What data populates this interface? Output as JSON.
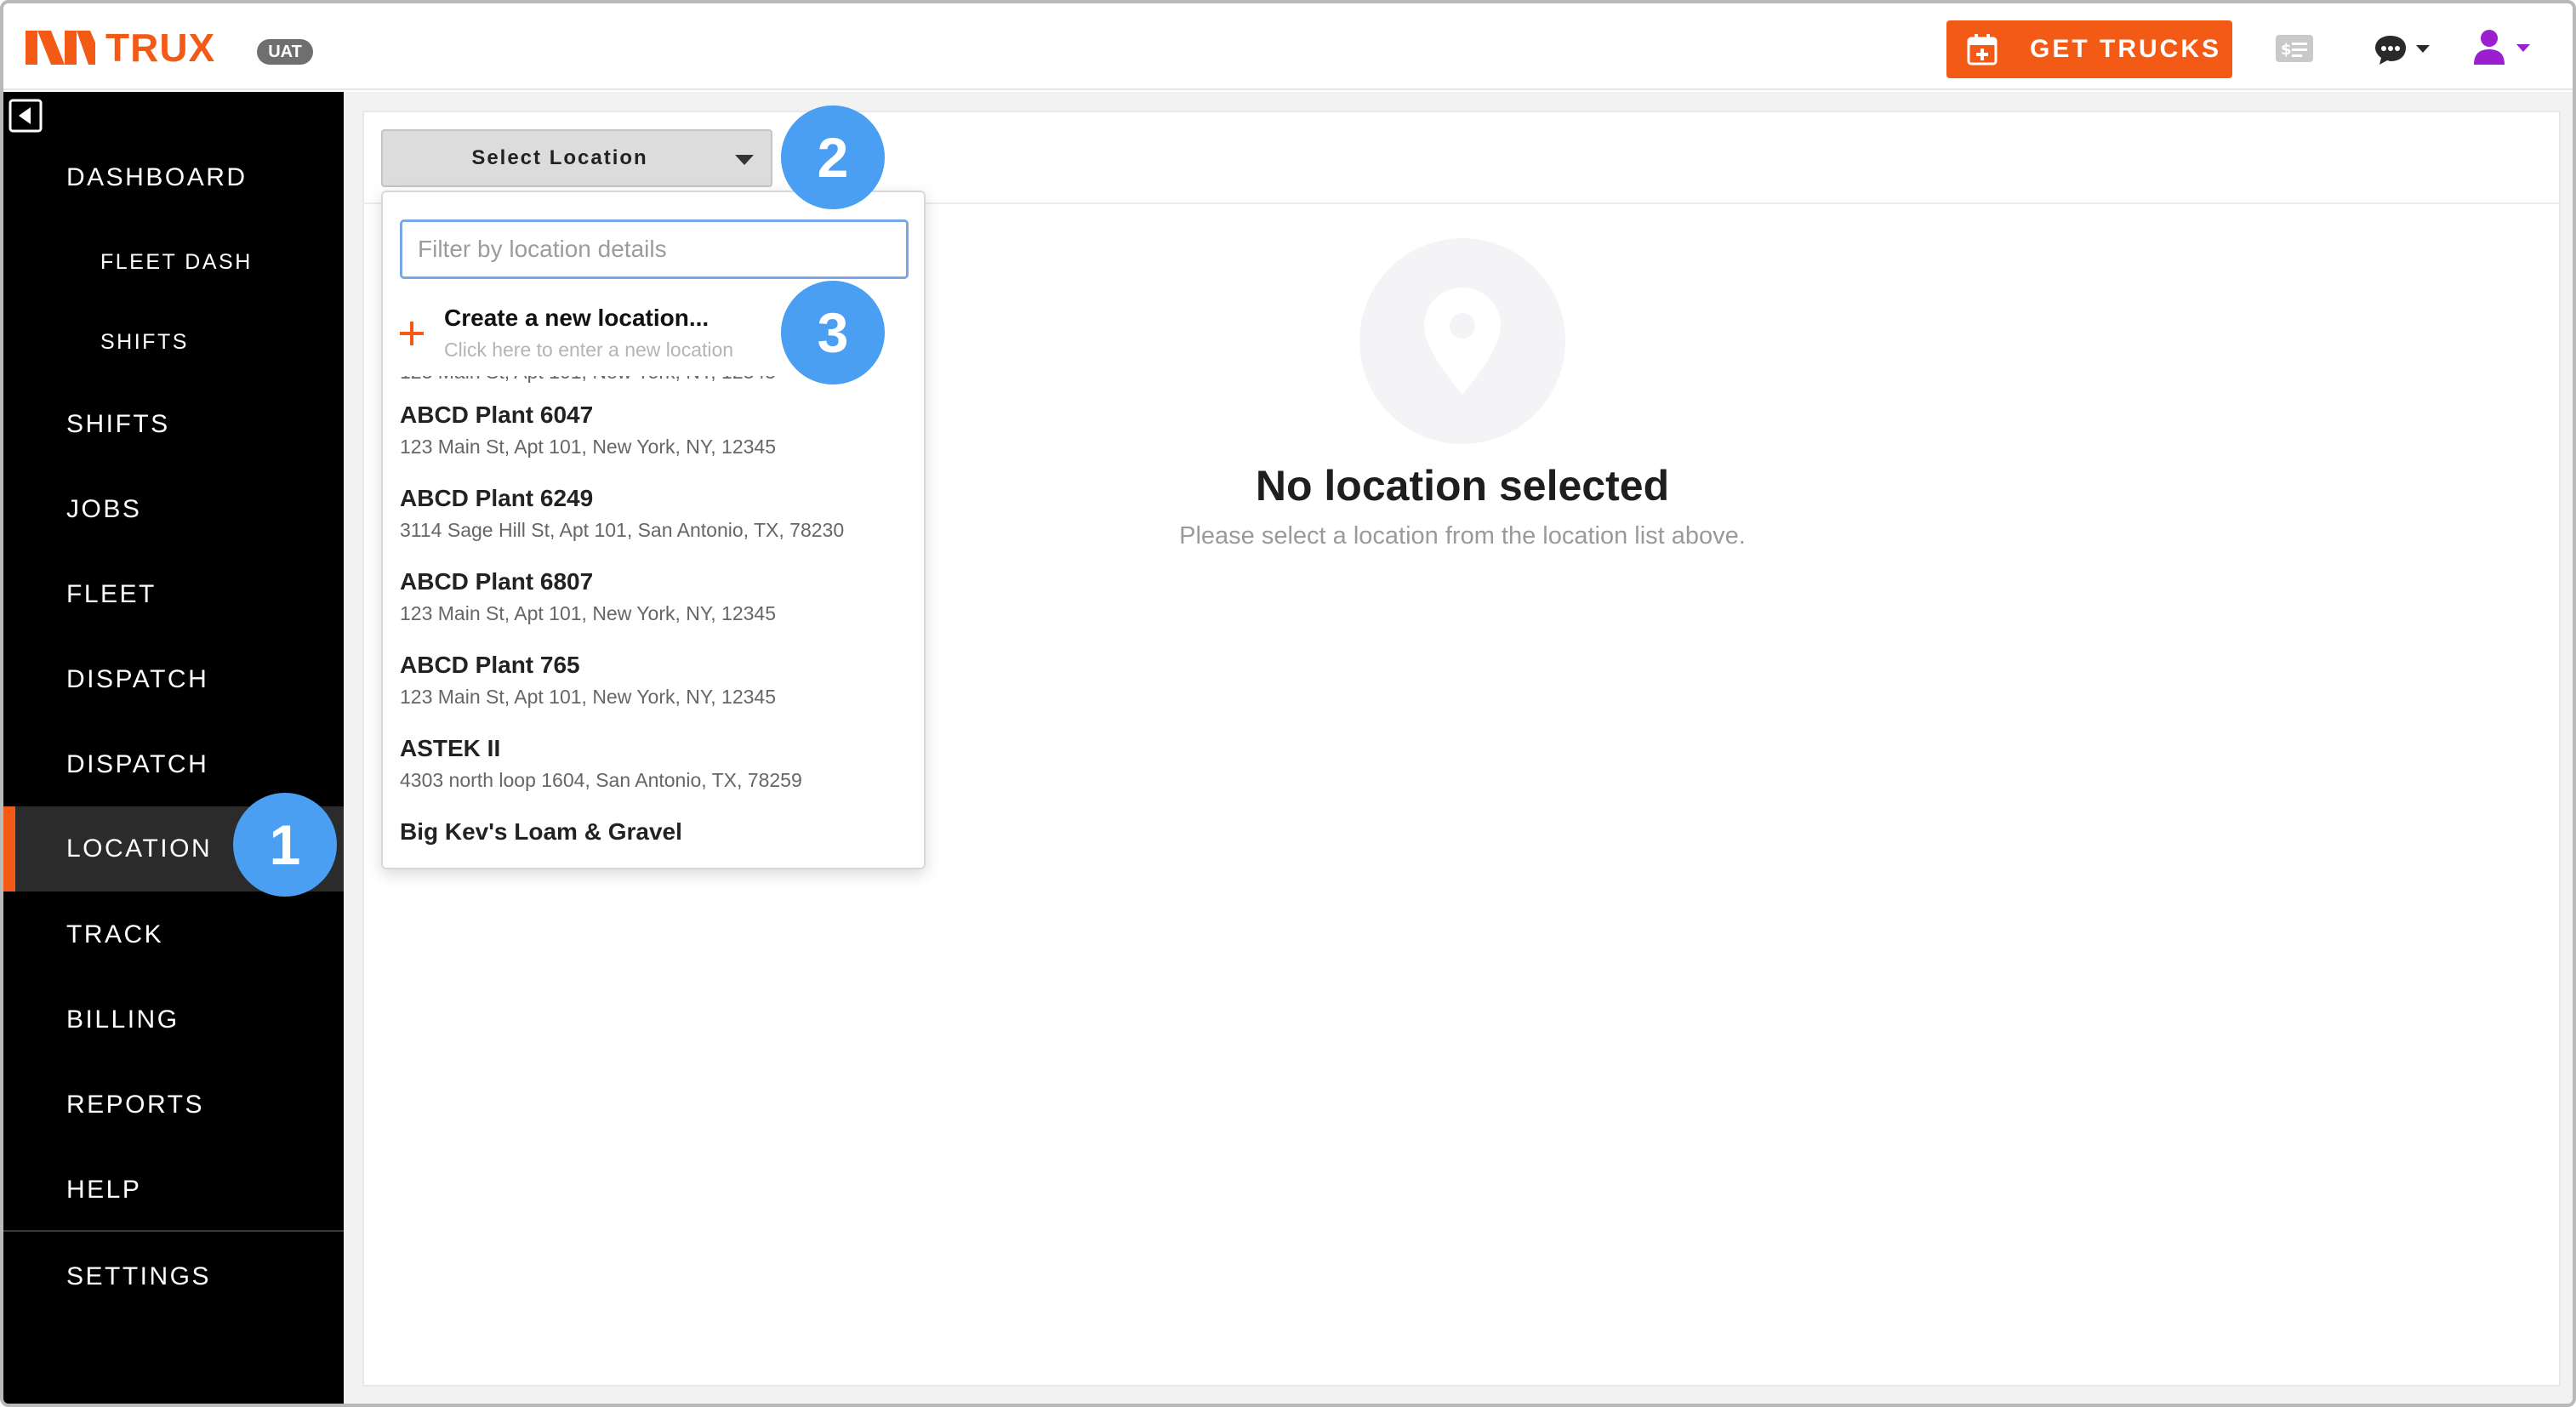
{
  "header": {
    "brand": "TRUX",
    "env_badge": "UAT",
    "get_trucks_label": "GET TRUCKS",
    "icons": [
      "calendar-plus-icon",
      "billing-icon",
      "chat-icon",
      "user-icon"
    ],
    "accent_color": "#f25a16"
  },
  "sidebar": {
    "items": [
      {
        "label": "DASHBOARD"
      },
      {
        "label": "FLEET DASH"
      },
      {
        "label": "SHIFTS"
      },
      {
        "label": "SHIFTS"
      },
      {
        "label": "JOBS"
      },
      {
        "label": "FLEET"
      },
      {
        "label": "DISPATCH"
      },
      {
        "label": "DISPATCH"
      },
      {
        "label": "LOCATION"
      },
      {
        "label": "TRACK"
      },
      {
        "label": "BILLING"
      },
      {
        "label": "REPORTS"
      },
      {
        "label": "HELP"
      },
      {
        "label": "SETTINGS"
      }
    ],
    "active": "LOCATION"
  },
  "toolbar": {
    "select_location_label": "Select Location"
  },
  "dropdown": {
    "filter_placeholder": "Filter by location details",
    "create": {
      "title": "Create a new location...",
      "subtitle": "Click here to enter a new location"
    },
    "partial_addr": "123 Main St, Apt 101, New York, NY, 12345",
    "locations": [
      {
        "name": "ABCD Plant 6047",
        "address": "123 Main St, Apt 101, New York, NY, 12345"
      },
      {
        "name": "ABCD Plant 6249",
        "address": "3114 Sage Hill St, Apt 101, San Antonio, TX, 78230"
      },
      {
        "name": "ABCD Plant 6807",
        "address": "123 Main St, Apt 101, New York, NY, 12345"
      },
      {
        "name": "ABCD Plant 765",
        "address": "123 Main St, Apt 101, New York, NY, 12345"
      },
      {
        "name": "ASTEK II",
        "address": "4303 north loop 1604, San Antonio, TX, 78259"
      },
      {
        "name": "Big Kev's Loam & Gravel",
        "address": ""
      }
    ]
  },
  "empty_state": {
    "title": "No location selected",
    "subtitle": "Please select a location from the location list above."
  },
  "callouts": [
    "1",
    "2",
    "3"
  ],
  "callout_color": "#4a9ff2"
}
